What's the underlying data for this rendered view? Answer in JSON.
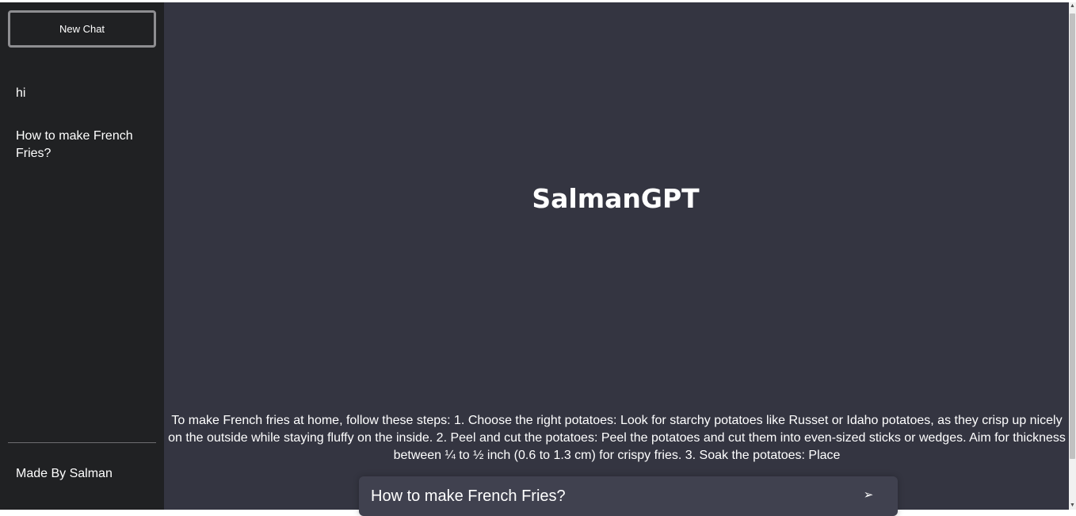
{
  "sidebar": {
    "new_chat_label": "New Chat",
    "history": [
      {
        "label": "hi"
      },
      {
        "label": "How to make French Fries?"
      }
    ],
    "footer_text": "Made By Salman"
  },
  "main": {
    "title": "SalmanGPT",
    "answer_text": "To make French fries at home, follow these steps: 1. Choose the right potatoes: Look for starchy potatoes like Russet or Idaho potatoes, as they crisp up nicely on the outside while staying fluffy on the inside. 2. Peel and cut the potatoes: Peel the potatoes and cut them into even-sized sticks or wedges. Aim for thickness between ¼ to ½ inch (0.6 to 1.3 cm) for crispy fries. 3. Soak the potatoes: Place",
    "input_value": "How to make French Fries?",
    "send_icon": "➢"
  },
  "colors": {
    "sidebar_bg": "#202123",
    "main_bg": "#343541",
    "input_bg": "#40414f",
    "text": "#ffffff"
  },
  "icons": {
    "send": "send-arrow-icon",
    "scroll_up": "scroll-up-arrow-icon",
    "scroll_down": "scroll-down-arrow-icon"
  },
  "scrollbar": {
    "up_glyph": "▲",
    "down_glyph": "▼"
  }
}
